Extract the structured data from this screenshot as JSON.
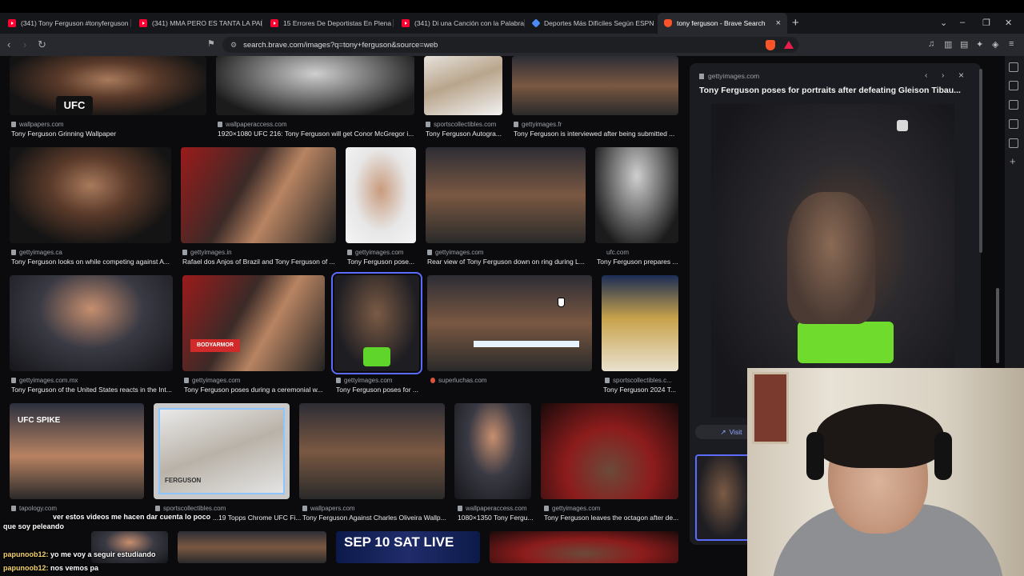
{
  "tabs": [
    {
      "title": "(341) Tony Ferguson #tonyferguson",
      "icon": "youtube-icon"
    },
    {
      "title": "(341) MMA PERO ES TANTA LA PALIZ",
      "icon": "youtube-icon"
    },
    {
      "title": "15 Errores De Deportistas En Plena C",
      "icon": "youtube-icon"
    },
    {
      "title": "(341) Di una Canción con la Palabra...",
      "icon": "youtube-icon"
    },
    {
      "title": "Deportes Más Difíciles Según ESPN",
      "icon": "espn-icon"
    },
    {
      "title": "tony ferguson - Brave Search",
      "icon": "brave-icon",
      "active": true
    }
  ],
  "toolbar": {
    "url": "search.brave.com/images?q=tony+ferguson&source=web",
    "new_tab": "+",
    "close_tab": "×",
    "back": "‹",
    "forward": "›",
    "reload": "↻"
  },
  "results": {
    "row1": [
      {
        "source": "wallpapers.com",
        "caption": "Tony Ferguson Grinning Wallpaper"
      },
      {
        "source": "wallpaperaccess.com",
        "caption": "1920×1080 UFC 216: Tony Ferguson will get Conor McGregor i..."
      },
      {
        "source": "sportscollectibles.com",
        "caption": "Tony Ferguson Autogra..."
      },
      {
        "source": "gettyimages.fr",
        "caption": "Tony Ferguson is interviewed after being submitted ..."
      }
    ],
    "row2": [
      {
        "source": "gettyimages.ca",
        "caption": "Tony Ferguson looks on while competing against A..."
      },
      {
        "source": "gettyimages.in",
        "caption": "Rafael dos Anjos of Brazil and Tony Ferguson of ..."
      },
      {
        "source": "gettyimages.com",
        "caption": "Tony Ferguson pose..."
      },
      {
        "source": "gettyimages.com",
        "caption": "Rear view of Tony Ferguson down on ring during L..."
      },
      {
        "source": "ufc.com",
        "caption": "Tony Ferguson prepares ..."
      }
    ],
    "row3": [
      {
        "source": "gettyimages.com.mx",
        "caption": "Tony Ferguson of the United States reacts in the Int..."
      },
      {
        "source": "gettyimages.com",
        "caption": "Tony Ferguson poses during a ceremonial w..."
      },
      {
        "source": "gettyimages.com",
        "caption": "Tony Ferguson poses for ..."
      },
      {
        "source": "superluchas.com",
        "caption": ""
      },
      {
        "source": "sportscollectibles.c...",
        "caption": "Tony Ferguson 2024 T..."
      }
    ],
    "row4": [
      {
        "source": "tapology.com",
        "caption": ""
      },
      {
        "source": "sportscollectibles.com",
        "caption": "...19 Topps Chrome UFC Fi..."
      },
      {
        "source": "wallpapers.com",
        "caption": "Tony Ferguson Against Charles Oliveira Wallp..."
      },
      {
        "source": "wallpaperaccess.com",
        "caption": "1080×1350 Tony Fergu..."
      },
      {
        "source": "gettyimages.com",
        "caption": "Tony Ferguson leaves the octagon after de..."
      }
    ],
    "row5_poster_text": "SEP 10 SAT LIVE"
  },
  "thumb_text": {
    "ufc_logo": "UFC",
    "bodyarmor": "BODYARMOR",
    "ufc_spike": "UFC SPIKE",
    "card_name": "FERGUSON"
  },
  "panel": {
    "source": "gettyimages.com",
    "title": "Tony Ferguson poses for portraits after defeating Gleison Tibau...",
    "visit_label": "Visit",
    "prev": "‹",
    "next": "›",
    "close": "×"
  },
  "chat": [
    {
      "user": "",
      "message": "ver estos videos me hacen dar cuenta lo poco"
    },
    {
      "user": "",
      "message": "que soy peleando"
    },
    {
      "user": "papunoob12:",
      "message": "yo me voy a seguir estudiando"
    },
    {
      "user": "papunoob12:",
      "message": "nos vemos pa"
    }
  ]
}
